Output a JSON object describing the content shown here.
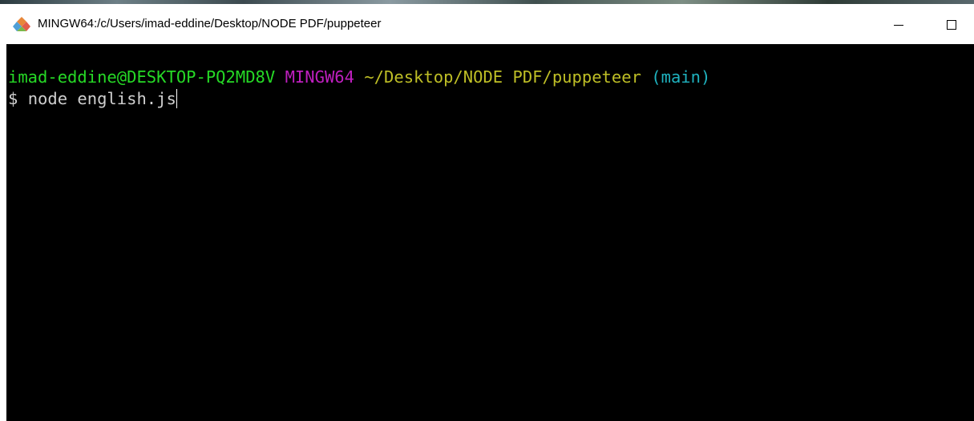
{
  "window": {
    "title": "MINGW64:/c/Users/imad-eddine/Desktop/NODE PDF/puppeteer",
    "app_icon": "git-bash-icon",
    "controls": {
      "minimize_icon": "minimize-icon",
      "maximize_icon": "maximize-icon"
    }
  },
  "terminal": {
    "prompt": {
      "user_host": "imad-eddine@DESKTOP-PQ2MD8V",
      "shell": "MINGW64",
      "cwd": "~/Desktop/NODE PDF/puppeteer",
      "branch": "(main)"
    },
    "input": {
      "prompt_char": "$",
      "command": "node english.js"
    },
    "colors": {
      "background": "#000000",
      "user_host": "#26d926",
      "shell": "#bf1fbf",
      "cwd": "#bfbf26",
      "branch": "#1fb2bf",
      "text": "#cfcfcf"
    }
  }
}
